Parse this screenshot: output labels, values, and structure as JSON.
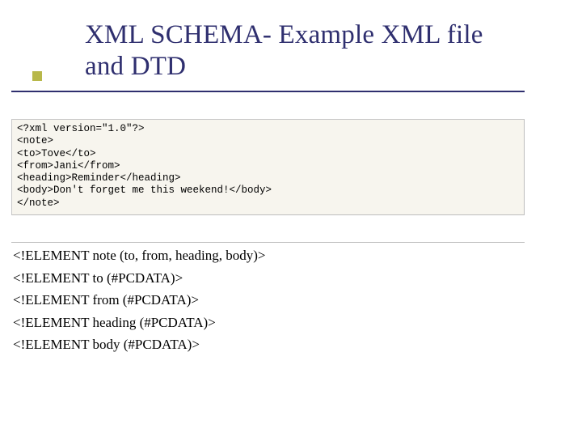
{
  "title": {
    "line1": "XML SCHEMA- Example XML file",
    "line2": "and  DTD"
  },
  "xml_example": {
    "lines": [
      "<?xml version=\"1.0\"?>",
      "<note>",
      "<to>Tove</to>",
      "<from>Jani</from>",
      "<heading>Reminder</heading>",
      "<body>Don't forget me this weekend!</body>",
      "</note>"
    ]
  },
  "dtd": {
    "lines": [
      "<!ELEMENT note (to, from, heading, body)>",
      "<!ELEMENT to (#PCDATA)>",
      "<!ELEMENT from (#PCDATA)>",
      "<!ELEMENT heading (#PCDATA)>",
      "<!ELEMENT body (#PCDATA)>"
    ]
  }
}
